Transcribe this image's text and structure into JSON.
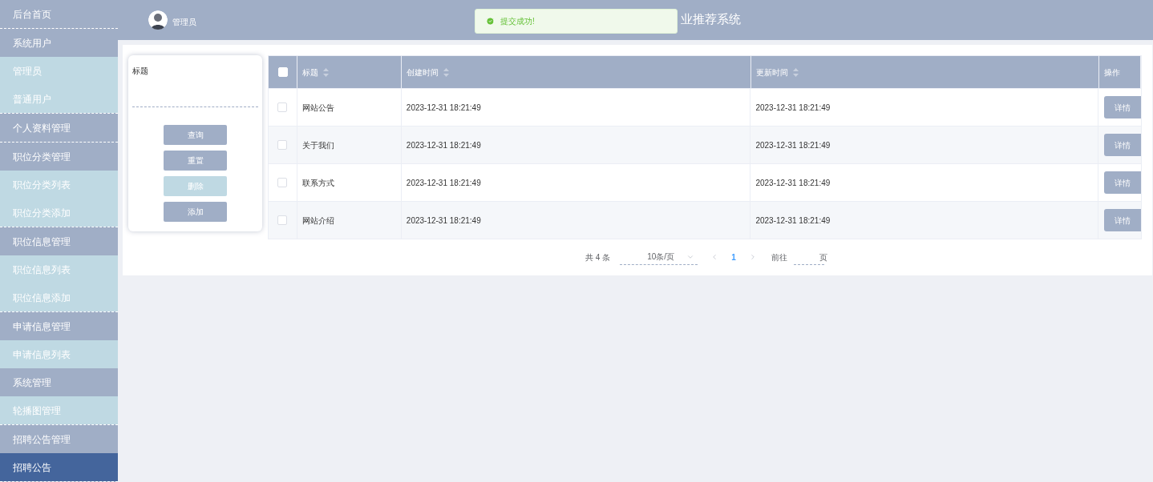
{
  "sidebar": {
    "groups": [
      {
        "items": [
          {
            "label": "后台首页",
            "kind": "menu",
            "selected": false
          }
        ]
      },
      {
        "items": [
          {
            "label": "系统用户",
            "kind": "menu",
            "selected": false
          },
          {
            "label": "管理员",
            "kind": "sub",
            "selected": false
          },
          {
            "label": "普通用户",
            "kind": "sub",
            "selected": false
          }
        ]
      },
      {
        "items": [
          {
            "label": "个人资料管理",
            "kind": "menu",
            "selected": false
          }
        ]
      },
      {
        "items": [
          {
            "label": "职位分类管理",
            "kind": "menu",
            "selected": false
          },
          {
            "label": "职位分类列表",
            "kind": "sub",
            "selected": false
          },
          {
            "label": "职位分类添加",
            "kind": "sub",
            "selected": false
          }
        ]
      },
      {
        "items": [
          {
            "label": "职位信息管理",
            "kind": "menu",
            "selected": false
          },
          {
            "label": "职位信息列表",
            "kind": "sub",
            "selected": false
          },
          {
            "label": "职位信息添加",
            "kind": "sub",
            "selected": false
          }
        ]
      },
      {
        "items": [
          {
            "label": "申请信息管理",
            "kind": "menu",
            "selected": false
          },
          {
            "label": "申请信息列表",
            "kind": "sub",
            "selected": false
          },
          {
            "label": "系统管理",
            "kind": "menu",
            "selected": false
          },
          {
            "label": "轮播图管理",
            "kind": "sub",
            "selected": false
          }
        ]
      },
      {
        "items": [
          {
            "label": "招聘公告管理",
            "kind": "menu",
            "selected": false
          },
          {
            "label": "招聘公告",
            "kind": "sub",
            "selected": true
          }
        ]
      }
    ]
  },
  "header": {
    "user": "管理员",
    "title": "业推荐系统"
  },
  "toast": {
    "message": "提交成功!"
  },
  "search": {
    "label": "标题",
    "buttons": [
      {
        "label": "查询",
        "disabled": false
      },
      {
        "label": "重置",
        "disabled": false
      },
      {
        "label": "删除",
        "disabled": true
      },
      {
        "label": "添加",
        "disabled": false
      }
    ]
  },
  "table": {
    "header_checked": false,
    "columns": [
      {
        "label": "标题",
        "sortable": true
      },
      {
        "label": "创建时间",
        "sortable": true
      },
      {
        "label": "更新时间",
        "sortable": true
      },
      {
        "label": "操作",
        "sortable": false
      }
    ],
    "rows": [
      {
        "checked": false,
        "cells": [
          "网站公告",
          "2023-12-31 18:21:49",
          "2023-12-31 18:21:49"
        ],
        "action": "详情"
      },
      {
        "checked": false,
        "cells": [
          "关于我们",
          "2023-12-31 18:21:49",
          "2023-12-31 18:21:49"
        ],
        "action": "详情"
      },
      {
        "checked": false,
        "cells": [
          "联系方式",
          "2023-12-31 18:21:49",
          "2023-12-31 18:21:49"
        ],
        "action": "详情"
      },
      {
        "checked": false,
        "cells": [
          "网站介绍",
          "2023-12-31 18:21:49",
          "2023-12-31 18:21:49"
        ],
        "action": "详情"
      }
    ]
  },
  "pagination": {
    "total": "共 4 条",
    "page_size": "10条/页",
    "pages": [
      {
        "label": "1",
        "selected": true
      }
    ],
    "goto": "前往",
    "page_unit": "页"
  }
}
